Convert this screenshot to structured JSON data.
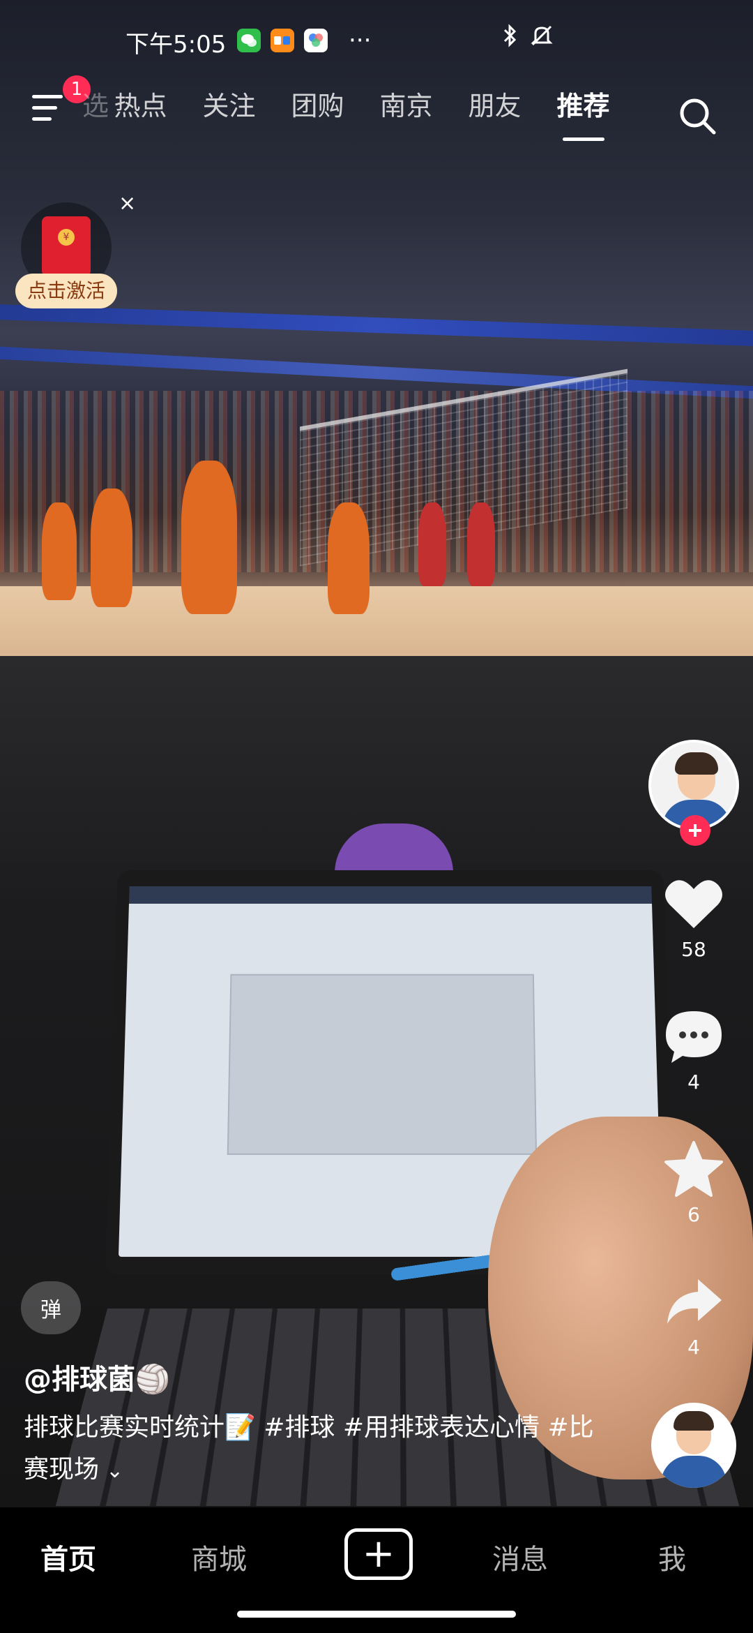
{
  "status_bar": {
    "time": "下午5:05",
    "more": "···",
    "icons": [
      "wechat-icon",
      "58-app-icon",
      "photos-app-icon",
      "bluetooth-icon",
      "mute-icon",
      "battery-icon"
    ]
  },
  "top_nav": {
    "menu_badge": "1",
    "partial_tab": "选",
    "tabs": [
      "热点",
      "关注",
      "团购",
      "南京",
      "朋友",
      "推荐"
    ],
    "active_tab": "推荐"
  },
  "red_packet": {
    "coin": "¥",
    "label": "点击激活",
    "close": "×"
  },
  "right_rail": {
    "like_count": "58",
    "comment_count": "4",
    "favorite_count": "6",
    "share_count": "4"
  },
  "danmaku": {
    "label": "弹"
  },
  "post": {
    "username": "@排球菌🏐",
    "description": "排球比赛实时统计📝 #排球 #用排球表达心情 #比赛现场",
    "expand": "⌄"
  },
  "bottom_nav": {
    "home": "首页",
    "mall": "商城",
    "create": "+",
    "messages": "消息",
    "me": "我"
  },
  "colors": {
    "accent": "#ff2d55",
    "red_packet": "#e0202f",
    "active_text": "#ffffff"
  }
}
